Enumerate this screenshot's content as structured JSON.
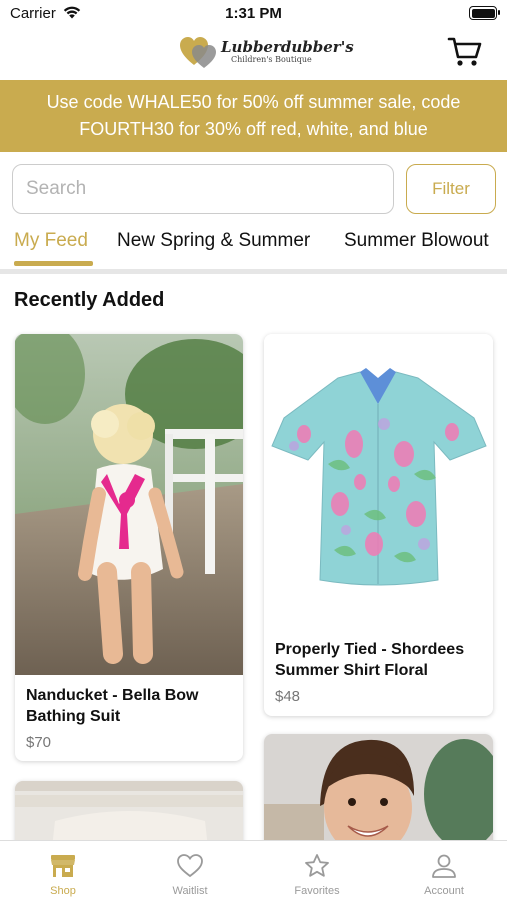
{
  "status_bar": {
    "carrier": "Carrier",
    "time": "1:31 PM"
  },
  "header": {
    "brand": "Lubberdubber's",
    "tagline": "Children's Boutique"
  },
  "promo": {
    "line1": "Use code WHALE50 for 50% off summer sale, code",
    "line2": "FOURTH30 for 30% off red, white, and blue"
  },
  "search": {
    "placeholder": "Search",
    "value": "",
    "filter_label": "Filter"
  },
  "tabs": [
    {
      "label": "My Feed",
      "active": true
    },
    {
      "label": "New Spring & Summer",
      "active": false
    },
    {
      "label": "Summer Blowout",
      "active": false
    }
  ],
  "section": {
    "title": "Recently Added"
  },
  "products": [
    {
      "name_line1": "Nanducket - Bella Bow",
      "name_line2": "Bathing Suit",
      "price": "$70"
    },
    {
      "name_line1": "Properly Tied - Shordees",
      "name_line2": "Summer Shirt Floral",
      "price": "$48"
    },
    {
      "name_line1": "",
      "name_line2": "",
      "price": ""
    },
    {
      "name_line1": "",
      "name_line2": "",
      "price": ""
    }
  ],
  "tab_bar": [
    {
      "label": "Shop",
      "icon": "shop-icon",
      "active": true
    },
    {
      "label": "Waitlist",
      "icon": "heart-icon",
      "active": false
    },
    {
      "label": "Favorites",
      "icon": "star-icon",
      "active": false
    },
    {
      "label": "Account",
      "icon": "person-icon",
      "active": false
    }
  ],
  "colors": {
    "accent": "#c9ab4f",
    "inactive": "#9a9a9a"
  }
}
